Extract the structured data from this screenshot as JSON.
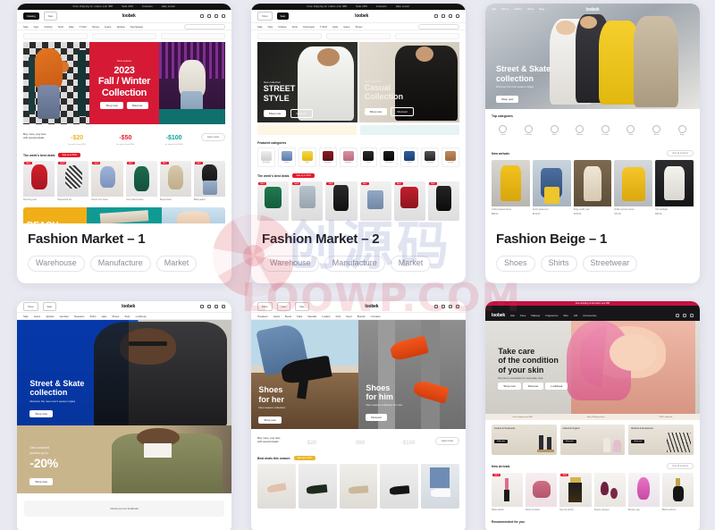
{
  "page": {
    "background_color": "#e9e9f1",
    "watermark": {
      "cjk": "创源码",
      "text": "LOOWP.COM"
    }
  },
  "cards": [
    {
      "title": "Fashion Market – 1",
      "tags": [
        "Warehouse",
        "Manufacture",
        "Market"
      ],
      "preview": {
        "logo": "loobek",
        "topbar": [
          "Free shipping on orders over $50",
          "Sale 20%",
          "Contacts",
          "Help center"
        ],
        "menu": [
          "Sale",
          "New",
          "Clothes",
          "Suits",
          "Hats",
          "T-Shirt",
          "Shoes",
          "Jeans",
          "Jackets",
          "Sportswear",
          "Lookbook",
          "Blog",
          "Pages"
        ],
        "hero": {
          "kicker": "New season",
          "year": "2023",
          "line1": "Fall / Winter",
          "line2": "Collection",
          "btn1": "Shop now",
          "btn2": "Discover"
        },
        "value_props": {
          "label": "Buy more, pay less with special deals",
          "tiers": [
            "-$20",
            "-$50",
            "-$100"
          ],
          "tier_caps": [
            "for orders from $150",
            "for orders from $300",
            "for orders from $600"
          ],
          "cta": "Learn more"
        },
        "section": {
          "title": "The week's best deals",
          "chip": "Sale up to 50%",
          "badge": "SALE"
        }
      }
    },
    {
      "title": "Fashion Market – 2",
      "tags": [
        "Warehouse",
        "Manufacture",
        "Market"
      ],
      "preview": {
        "logo": "loobek",
        "topbar": [
          "Free shipping on orders over $50",
          "Sale 20%",
          "Contacts",
          "Help center"
        ],
        "menu": [
          "Sale",
          "New",
          "Clothes",
          "Suits",
          "Outerwear",
          "T-Shirt",
          "Hats",
          "Jeans",
          "Shoes",
          "Sportswear",
          "Lookbook",
          "Blog"
        ],
        "hero_left": {
          "kicker": "New collection",
          "line1": "STREET",
          "line2": "STYLE",
          "btn1": "Shop now",
          "btn2": "Discover"
        },
        "hero_right": {
          "kicker": "New collection",
          "line1": "Casual",
          "line2": "Collection",
          "btn1": "Shop now",
          "btn2": "Discover"
        },
        "section_categories": "Featured categories",
        "categories": [
          "Sneakers",
          "Jeans",
          "Hats",
          "Sweaters",
          "Hoodies",
          "Suits",
          "Watches",
          "Shirts",
          "Glasses",
          "Jackets"
        ],
        "section": {
          "title": "The week's best deals",
          "chip": "Sale up to 50%",
          "badge": "SALE"
        }
      }
    },
    {
      "title": "Fashion Beige – 1",
      "tags": [
        "Shoes",
        "Shirts",
        "Streetwear"
      ],
      "preview": {
        "logo": "loobek",
        "menu": [
          "Sale",
          "New in",
          "Clothes",
          "Shoes",
          "Bags",
          "Lookbook",
          "Blog"
        ],
        "hero": {
          "line1": "Street & Skate",
          "line2": "collection",
          "sub": "Discover the new season styles",
          "btn": "Shop now"
        },
        "section_categories": "Top categories",
        "categories": [
          "Coats",
          "Knitwear",
          "Skirts",
          "Blouses",
          "Dresses",
          "Pants",
          "Shoes",
          "Bags"
        ],
        "section": {
          "title": "New arrivals",
          "more": "View all products"
        },
        "product_caps": [
          "Yellow pleated dress",
          "Denim jacket set",
          "Beige teddy coat",
          "Ruffle summer dress",
          "Knit cardigan"
        ],
        "product_prices": [
          "$89.00",
          "$124.00",
          "$159.00",
          "$74.00",
          "$98.00"
        ]
      }
    },
    {
      "title": "",
      "tags": [],
      "preview": {
        "logo": "loobek",
        "menu": [
          "Sale",
          "Jeans",
          "Jackets",
          "Hoodies",
          "Sweaters",
          "Shirts",
          "Hats",
          "Shoes",
          "Suits",
          "Lookbook",
          "Sportswear",
          "Pages"
        ],
        "hero": {
          "line1": "Street & Skate",
          "line2": "collection",
          "sub": "Discover the new men's season styles",
          "btn": "Shop now"
        },
        "promo": {
          "line1": "One-coloured",
          "line2": "jackets up to",
          "value": "-20%",
          "btn": "Shop now"
        },
        "footer_btn": "Check out our lookbook"
      }
    },
    {
      "title": "",
      "tags": [],
      "preview": {
        "logo": "loobek",
        "menu": [
          "Sneakers",
          "Heels",
          "Boots",
          "Flats",
          "Sandals",
          "Loafers",
          "Kids",
          "Sport",
          "Brands",
          "Contacts",
          "Sale",
          "Pages"
        ],
        "hero_left": {
          "line1": "Shoes",
          "line2": "for her",
          "sub": "New season collection",
          "btn": "Shop now"
        },
        "hero_right": {
          "line1": "Shoes",
          "line2": "for him",
          "sub": "New season collection for men",
          "btn": "Discover"
        },
        "value_props": {
          "label": "Buy more, pay less with special deals",
          "tiers": [
            "-$20",
            "-$50",
            "-$100"
          ],
          "cta": "Learn more"
        },
        "section": {
          "title": "Best deals this season",
          "chip": "Sale up to 40%"
        }
      }
    },
    {
      "title": "",
      "tags": [],
      "preview": {
        "logo": "loobek",
        "topbar": "Free shipping on all orders over $50",
        "menu": [
          "Hair",
          "Face",
          "Makeup",
          "Fragrances",
          "Skin",
          "Gift",
          "Accessories",
          "Sale",
          "Pages"
        ],
        "hero": {
          "line1": "Take care",
          "line2": "of the condition",
          "line3": "of your skin",
          "sub": "Premium cosmetics for everyday care",
          "btns": [
            "Shop now",
            "Discover",
            "Lookbook"
          ]
        },
        "banners": [
          {
            "title": "Creams & Treatments",
            "btn": "Shop now"
          },
          {
            "title": "Natural & Organic",
            "btn": "Shop now"
          },
          {
            "title": "Brushes & Accessories",
            "btn": "Shop now"
          }
        ],
        "section": {
          "title": "New Arrivals",
          "more": "View all products",
          "badge": "SALE"
        },
        "section2": "Recommended for you"
      }
    }
  ]
}
